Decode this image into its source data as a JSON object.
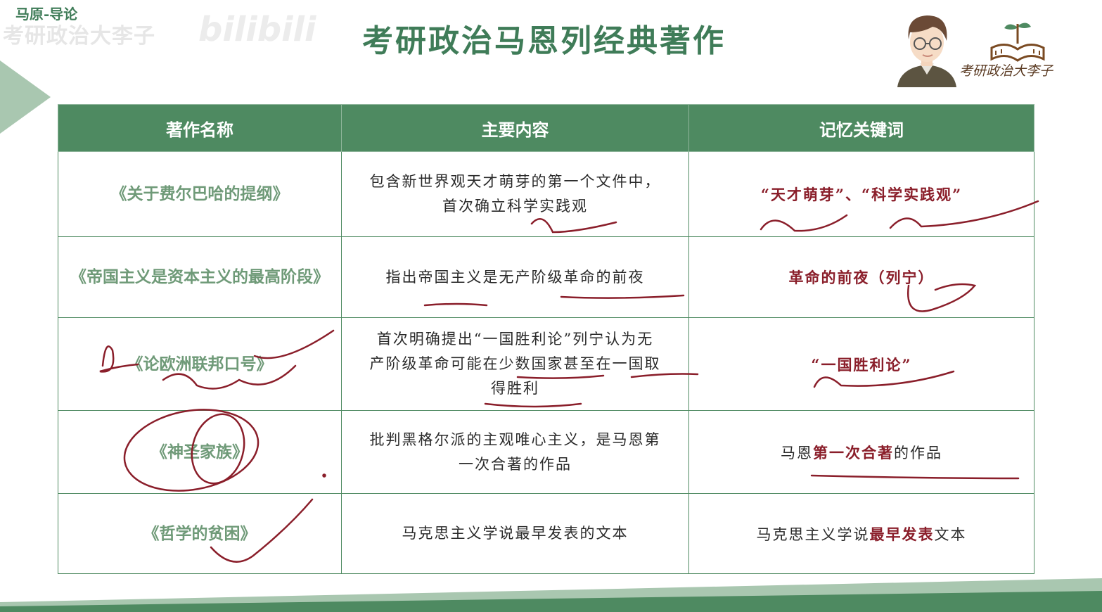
{
  "header": {
    "top_label": "马原-导论",
    "watermark_text": "考研政治大李子",
    "watermark_logo": "bilibili",
    "title": "考研政治马恩列经典著作",
    "brand_name": "考研政治大李子"
  },
  "table": {
    "columns": [
      "著作名称",
      "主要内容",
      "记忆关键词"
    ],
    "rows": [
      {
        "title": "《关于费尔巴哈的提纲》",
        "content": [
          "包含新世界观天才萌芽的第一个文件中，",
          "首次确立科学实践观"
        ],
        "keyword_red": "“天才萌芽”、“科学实践观”"
      },
      {
        "title": "《帝国主义是资本主义的最高阶段》",
        "content": [
          "指出帝国主义是无产阶级革命的前夜"
        ],
        "keyword_red": "革命的前夜（列宁）"
      },
      {
        "title": "《论欧洲联邦口号》",
        "content": [
          "首次明确提出“一国胜利论”列宁认为无",
          "产阶级革命可能在少数国家甚至在一国取",
          "得胜利"
        ],
        "keyword_red": "“一国胜利论”"
      },
      {
        "title": "《神圣家族》",
        "content": [
          "批判黑格尔派的主观唯心主义，是马恩第",
          "一次合著的作品"
        ],
        "keyword_pre": "马恩",
        "keyword_red": "第一次合著",
        "keyword_post": "的作品"
      },
      {
        "title": "《哲学的贫困》",
        "content": [
          "马克思主义学说最早发表的文本"
        ],
        "keyword_pre": "马克思主义学说",
        "keyword_red": "最早发表",
        "keyword_post": "文本"
      }
    ]
  },
  "colors": {
    "brand_green": "#4e8a61",
    "title_green": "#3f7c58",
    "annotation_red": "#8a1e2a"
  },
  "icons": [
    "avatar-illustration",
    "book-sprout-logo-icon",
    "side-arrow-decoration"
  ]
}
